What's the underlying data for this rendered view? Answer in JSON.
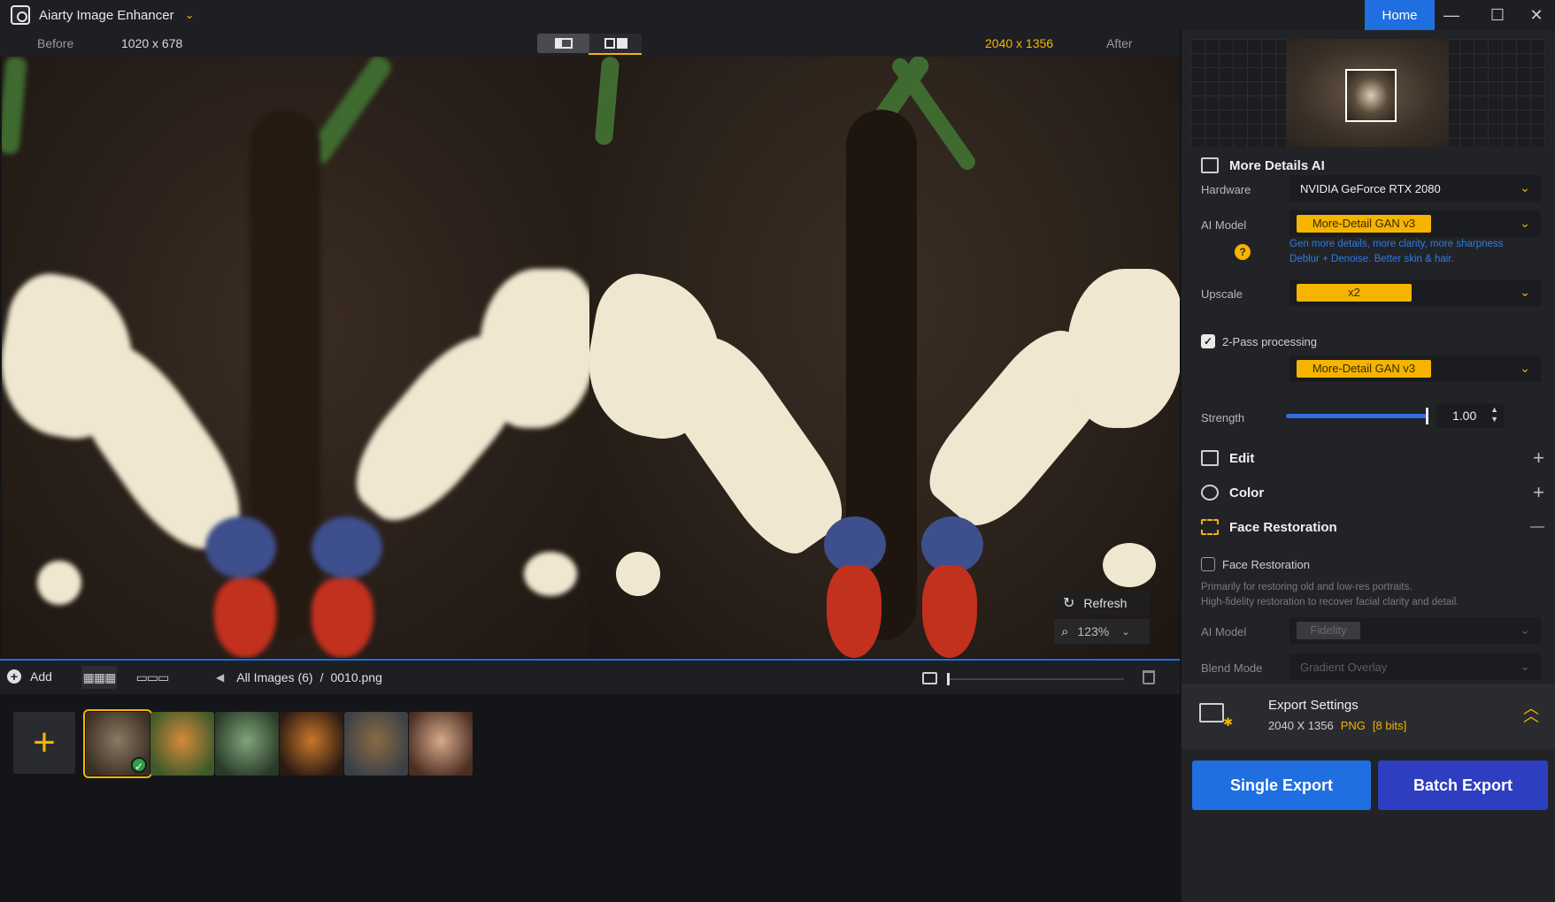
{
  "titlebar": {
    "app_name": "Aiarty Image Enhancer",
    "home_label": "Home",
    "min_glyph": "—",
    "max_glyph": "☐",
    "close_glyph": "✕"
  },
  "compare": {
    "before_label": "Before",
    "before_size": "1020 x 678",
    "after_size": "2040 x 1356",
    "after_label": "After"
  },
  "canvas_overlay": {
    "refresh_label": "Refresh",
    "zoom_value": "123%"
  },
  "bottom_bar": {
    "add_label": "Add",
    "breadcrumb_root": "All Images (6)",
    "breadcrumb_sep": "/",
    "breadcrumb_file": "0010.png",
    "size_slider_value": 0
  },
  "thumbnails": [
    {
      "name": "butterfly",
      "selected": true,
      "colors": [
        "#8a7a62",
        "#3a2f25"
      ]
    },
    {
      "name": "tiger",
      "selected": false,
      "colors": [
        "#d58a3a",
        "#3e5a2a"
      ]
    },
    {
      "name": "jar-figure",
      "selected": false,
      "colors": [
        "#7fa47a",
        "#2a3a28"
      ]
    },
    {
      "name": "burger",
      "selected": false,
      "colors": [
        "#c9772a",
        "#2a1a12"
      ]
    },
    {
      "name": "dog-goggles",
      "selected": false,
      "colors": [
        "#8a6a42",
        "#3a4048"
      ]
    },
    {
      "name": "portrait",
      "selected": false,
      "colors": [
        "#d7a98a",
        "#4a2e22"
      ]
    }
  ],
  "panel": {
    "more_details_title": "More Details AI",
    "hardware_label": "Hardware",
    "hardware_value": "NVIDIA GeForce RTX 2080",
    "ai_model_label": "AI Model",
    "ai_model_value": "More-Detail GAN  v3",
    "ai_model_desc_1": "Gen more details, more clarity, more sharpness",
    "ai_model_desc_2": "Deblur + Denoise. Better skin & hair.",
    "help_glyph": "?",
    "upscale_label": "Upscale",
    "upscale_value": "x2",
    "two_pass_label": "2-Pass processing",
    "two_pass_checked": true,
    "two_pass_model": "More-Detail GAN  v3",
    "strength_label": "Strength",
    "strength_value": "1.00",
    "strength_fraction": 1.0,
    "edit_title": "Edit",
    "color_title": "Color",
    "face_title": "Face Restoration",
    "face_checkbox_label": "Face Restoration",
    "face_checked": false,
    "face_desc_1": "Primarily for restoring old and low-res portraits.",
    "face_desc_2": "High-fidelity restoration to recover facial clarity and detail.",
    "face_ai_model_label": "AI Model",
    "face_ai_model_value": "Fidelity",
    "blend_label": "Blend Mode",
    "blend_value": "Gradient Overlay",
    "plus_glyph": "+",
    "minus_glyph": "—"
  },
  "export": {
    "title": "Export Settings",
    "size": "2040 X 1356",
    "format": "PNG",
    "bits": "[8 bits]",
    "single_label": "Single Export",
    "batch_label": "Batch Export"
  },
  "colors": {
    "accent_yellow": "#f5b400",
    "accent_blue": "#1f6fe0",
    "batch_blue": "#2d3fc0"
  }
}
